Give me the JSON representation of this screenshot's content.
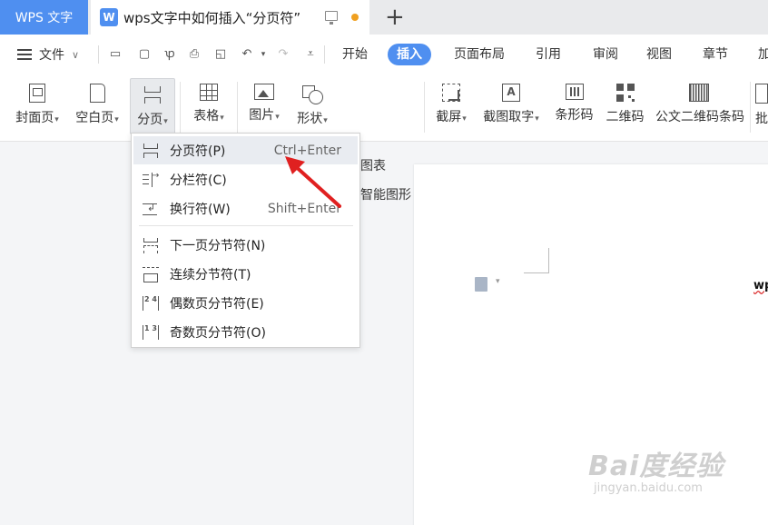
{
  "titlebar": {
    "app_tab": "WPS 文字",
    "doc_tab_icon": "W",
    "doc_tab_title": "wps文字中如何插入“分页符”",
    "monitor_icon": "monitor-icon",
    "unsaved_dot_color": "#f0a020",
    "new_tab": "+"
  },
  "menubar": {
    "file_menu": "文件",
    "tabs": [
      {
        "label": "开始"
      },
      {
        "label": "插入",
        "active": true
      },
      {
        "label": "页面布局"
      },
      {
        "label": "引用"
      },
      {
        "label": "审阅"
      },
      {
        "label": "视图"
      },
      {
        "label": "章节"
      },
      {
        "label": "加"
      }
    ]
  },
  "ribbon": {
    "cover": "封面页",
    "blank": "空白页",
    "break": "分页",
    "table": "表格",
    "picture": "图片",
    "shape": "形状",
    "chart": "图表",
    "smartart": "智能图形",
    "screenshot": "截屏",
    "ocr": "截图取字",
    "ocr_glyph": "A",
    "barcode": "条形码",
    "qrcode": "二维码",
    "gov_qrcode": "公文二维码条码",
    "cut_off": "批"
  },
  "dropdown": {
    "items": [
      {
        "label": "分页符(P)",
        "shortcut": "Ctrl+Enter"
      },
      {
        "label": "分栏符(C)",
        "shortcut": ""
      },
      {
        "label": "换行符(W)",
        "shortcut": "Shift+Enter"
      },
      {
        "label": "下一页分节符(N)",
        "shortcut": ""
      },
      {
        "label": "连续分节符(T)",
        "shortcut": ""
      },
      {
        "label": "偶数页分节符(E)",
        "shortcut": ""
      },
      {
        "label": "奇数页分节符(O)",
        "shortcut": ""
      }
    ],
    "even_glyph": "2 4",
    "odd_glyph": "1 3"
  },
  "document": {
    "visible_text": "wps"
  },
  "watermark": {
    "brand": "Bai度经验",
    "url": "jingyan.baidu.com"
  },
  "colors": {
    "accent": "#4f8ff0",
    "arrow": "#e02020"
  }
}
